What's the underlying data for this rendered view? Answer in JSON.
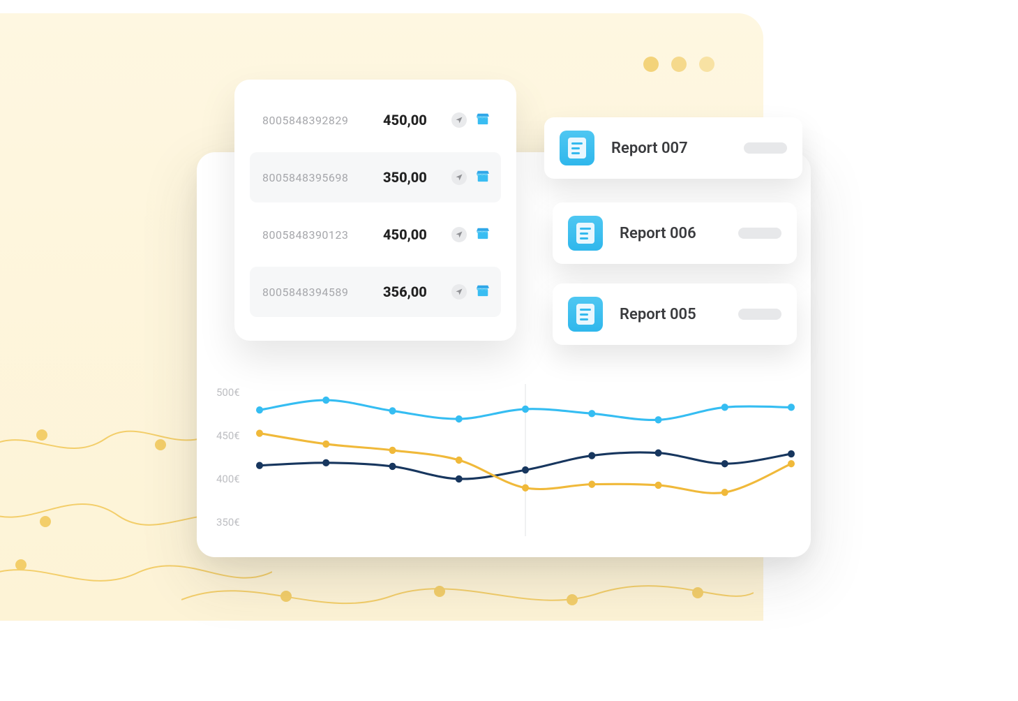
{
  "transactions": [
    {
      "id": "8005848392829",
      "amount": "450,00",
      "shaded": false
    },
    {
      "id": "8005848395698",
      "amount": "350,00",
      "shaded": true
    },
    {
      "id": "8005848390123",
      "amount": "450,00",
      "shaded": false
    },
    {
      "id": "8005848394589",
      "amount": "356,00",
      "shaded": true
    }
  ],
  "reports": [
    {
      "title": "Report 007"
    },
    {
      "title": "Report 006"
    },
    {
      "title": "Report 005"
    }
  ],
  "chart_data": {
    "type": "line",
    "xlabel": "",
    "ylabel": "",
    "currency": "€",
    "y_ticks": [
      500,
      450,
      400,
      350
    ],
    "ylim": [
      340,
      510
    ],
    "x_count": 9,
    "vline_index": 4,
    "series": [
      {
        "name": "blue",
        "color": "#35BDF2",
        "values": [
          481,
          492,
          480,
          471,
          482,
          477,
          470,
          484,
          484
        ]
      },
      {
        "name": "navy",
        "color": "#17365E",
        "values": [
          419,
          422,
          418,
          404,
          414,
          430,
          433,
          421,
          432
        ]
      },
      {
        "name": "gold",
        "color": "#F0B93A",
        "values": [
          455,
          443,
          436,
          425,
          394,
          398,
          397,
          389,
          421
        ]
      }
    ]
  },
  "colors": {
    "cream": "#FDF3D6",
    "accent_blue": "#35BDF2",
    "accent_navy": "#17365E",
    "accent_gold": "#F0B93A"
  }
}
